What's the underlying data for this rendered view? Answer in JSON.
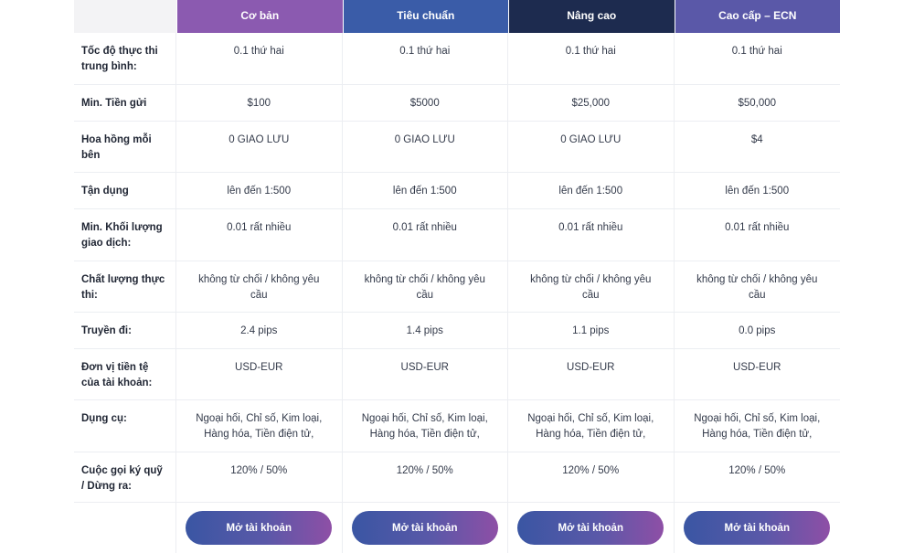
{
  "plans": [
    {
      "name": "Cơ bản",
      "color": "#8b5ab0"
    },
    {
      "name": "Tiêu chuẩn",
      "color": "#3a5ca8"
    },
    {
      "name": "Nâng cao",
      "color": "#1d2b4f"
    },
    {
      "name": "Cao cấp – ECN",
      "color": "#5a58a8"
    }
  ],
  "rows": [
    {
      "label": "Tốc độ thực thi trung bình:",
      "values": [
        "0.1 thứ hai",
        "0.1 thứ hai",
        "0.1 thứ hai",
        "0.1 thứ hai"
      ]
    },
    {
      "label": "Min. Tiền gửi",
      "values": [
        "$100",
        "$5000",
        "$25,000",
        "$50,000"
      ]
    },
    {
      "label": "Hoa hồng mỗi bên",
      "values": [
        "0 GIAO LƯU",
        "0 GIAO LƯU",
        "0 GIAO LƯU",
        "$4"
      ]
    },
    {
      "label": "Tận dụng",
      "values": [
        "lên đến 1:500",
        "lên đến 1:500",
        "lên đến 1:500",
        "lên đến 1:500"
      ]
    },
    {
      "label": "Min. Khối lượng giao dịch:",
      "values": [
        "0.01 rất nhiều",
        "0.01 rất nhiều",
        "0.01 rất nhiều",
        "0.01 rất nhiều"
      ]
    },
    {
      "label": "Chất lượng thực thi:",
      "values": [
        "không từ chối / không yêu cầu",
        "không từ chối / không yêu cầu",
        "không từ chối / không yêu cầu",
        "không từ chối / không yêu cầu"
      ]
    },
    {
      "label": "Truyền đi:",
      "values": [
        "2.4 pips",
        "1.4 pips",
        "1.1 pips",
        "0.0 pips"
      ]
    },
    {
      "label": "Đơn vị tiền tệ của tài khoản:",
      "values": [
        "USD-EUR",
        "USD-EUR",
        "USD-EUR",
        "USD-EUR"
      ]
    },
    {
      "label": "Dụng cụ:",
      "values": [
        "Ngoại hối, Chỉ số, Kim loại, Hàng hóa, Tiền điện tử,",
        "Ngoại hối, Chỉ số, Kim loại, Hàng hóa, Tiền điện tử,",
        "Ngoại hối, Chỉ số, Kim loại, Hàng hóa, Tiền điện tử,",
        "Ngoại hối, Chỉ số, Kim loại, Hàng hóa, Tiền điện tử,"
      ]
    },
    {
      "label": "Cuộc gọi ký quỹ / Dừng ra:",
      "values": [
        "120% / 50%",
        "120% / 50%",
        "120% / 50%",
        "120% / 50%"
      ]
    }
  ],
  "button_label": "Mở tài khoản"
}
